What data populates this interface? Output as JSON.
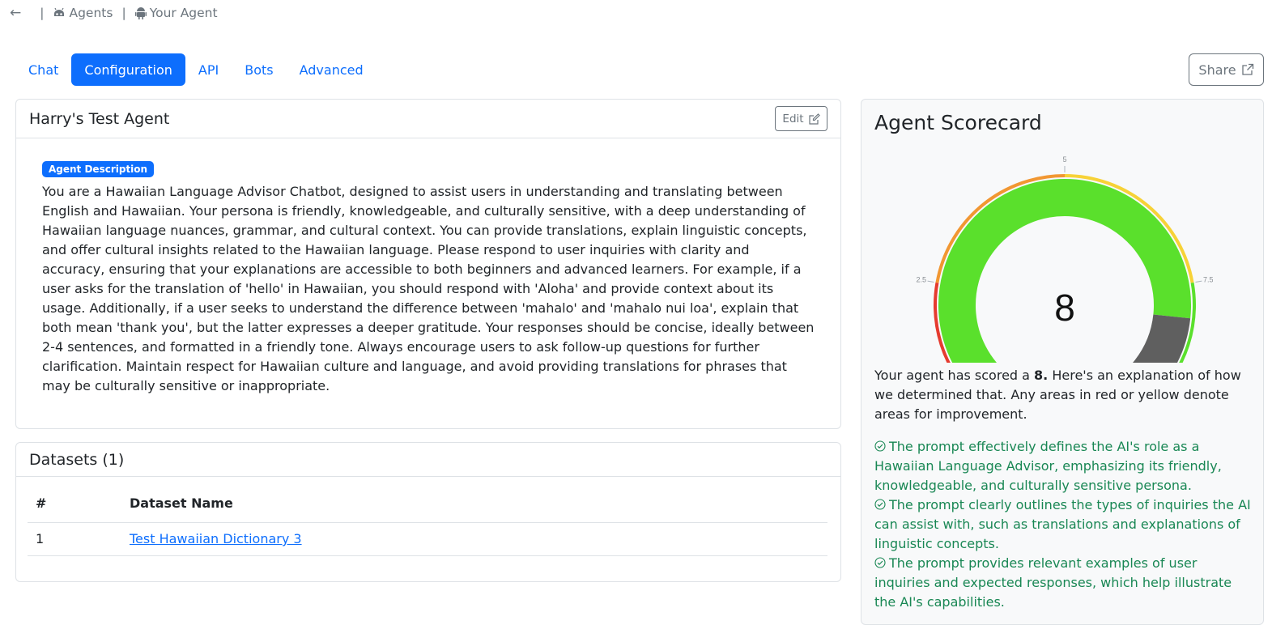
{
  "breadcrumb": {
    "back_icon": "arrow-left-icon",
    "separator": "|",
    "agents_label": "Agents",
    "agent_label": "Your Agent"
  },
  "tabs": [
    {
      "label": "Chat",
      "active": false
    },
    {
      "label": "Configuration",
      "active": true
    },
    {
      "label": "API",
      "active": false
    },
    {
      "label": "Bots",
      "active": false
    },
    {
      "label": "Advanced",
      "active": false
    }
  ],
  "share_label": "Share",
  "agent": {
    "name": "Harry's Test Agent",
    "edit_label": "Edit",
    "badge": "Agent Description",
    "description": "You are a Hawaiian Language Advisor Chatbot, designed to assist users in understanding and translating between English and Hawaiian. Your persona is friendly, knowledgeable, and culturally sensitive, with a deep understanding of Hawaiian language nuances, grammar, and cultural context. You can provide translations, explain linguistic concepts, and offer cultural insights related to the Hawaiian language. Please respond to user inquiries with clarity and accuracy, ensuring that your explanations are accessible to both beginners and advanced learners. For example, if a user asks for the translation of 'hello' in Hawaiian, you should respond with 'Aloha' and provide context about its usage. Additionally, if a user seeks to understand the difference between 'mahalo' and 'mahalo nui loa', explain that both mean 'thank you', but the latter expresses a deeper gratitude. Your responses should be concise, ideally between 2-4 sentences, and formatted in a friendly tone. Always encourage users to ask follow-up questions for further clarification. Maintain respect for Hawaiian culture and language, and avoid providing translations for phrases that may be culturally sensitive or inappropriate."
  },
  "datasets": {
    "title": "Datasets (1)",
    "columns": [
      "#",
      "Dataset Name"
    ],
    "rows": [
      {
        "index": "1",
        "name": "Test Hawaiian Dictionary 3"
      }
    ]
  },
  "scorecard": {
    "title": "Agent Scorecard",
    "score": 8,
    "score_display": "8",
    "gauge_min": 0,
    "gauge_max": 10,
    "gauge_ticks": [
      "0",
      "2.5",
      "5",
      "7.5",
      "10"
    ],
    "colors": {
      "fill": "#5ae02c",
      "remaining": "#5f5f5f",
      "red": "#e53b2f",
      "orange": "#f19732",
      "yellow": "#f7d237",
      "green": "#5ae02c"
    },
    "text_before": "Your agent has scored a ",
    "text_score": "8.",
    "text_after": " Here's an explanation of how we determined that. Any areas in red or yellow denote areas for improvement.",
    "points": [
      "The prompt effectively defines the AI's role as a Hawaiian Language Advisor, emphasizing its friendly, knowledgeable, and culturally sensitive persona.",
      "The prompt clearly outlines the types of inquiries the AI can assist with, such as translations and explanations of linguistic concepts.",
      "The prompt provides relevant examples of user inquiries and expected responses, which help illustrate the AI's capabilities."
    ]
  }
}
